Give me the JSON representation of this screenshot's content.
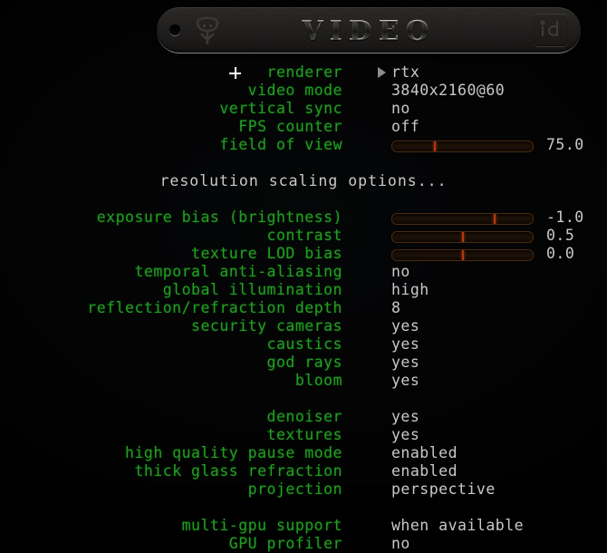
{
  "header": {
    "title": "VIDEO",
    "quake_logo": "quake-logo",
    "id_logo": "id-software-logo"
  },
  "cursor": {
    "icon": "crosshair-cursor"
  },
  "menu": {
    "selection_arrow": "play-arrow-icon",
    "rows": [
      {
        "type": "option",
        "label": "renderer",
        "value": "rtx",
        "selected": true
      },
      {
        "type": "option",
        "label": "video mode",
        "value": "3840x2160@60"
      },
      {
        "type": "option",
        "label": "vertical sync",
        "value": "no"
      },
      {
        "type": "option",
        "label": "FPS counter",
        "value": "off"
      },
      {
        "type": "slider",
        "label": "field of view",
        "value": "75.0",
        "fill": 30
      },
      {
        "type": "spacer"
      },
      {
        "type": "submenu",
        "label": "resolution scaling options..."
      },
      {
        "type": "spacer"
      },
      {
        "type": "slider",
        "label": "exposure bias (brightness)",
        "value": "-1.0",
        "fill": 73
      },
      {
        "type": "slider",
        "label": "contrast",
        "value": "0.5",
        "fill": 50
      },
      {
        "type": "slider",
        "label": "texture LOD bias",
        "value": "0.0",
        "fill": 50
      },
      {
        "type": "option",
        "label": "temporal anti-aliasing",
        "value": "no"
      },
      {
        "type": "option",
        "label": "global illumination",
        "value": "high"
      },
      {
        "type": "option",
        "label": "reflection/refraction depth",
        "value": "8"
      },
      {
        "type": "option",
        "label": "security cameras",
        "value": "yes"
      },
      {
        "type": "option",
        "label": "caustics",
        "value": "yes"
      },
      {
        "type": "option",
        "label": "god rays",
        "value": "yes"
      },
      {
        "type": "option",
        "label": "bloom",
        "value": "yes"
      },
      {
        "type": "spacer"
      },
      {
        "type": "option",
        "label": "denoiser",
        "value": "yes"
      },
      {
        "type": "option",
        "label": "textures",
        "value": "yes"
      },
      {
        "type": "option",
        "label": "high quality pause mode",
        "value": "enabled"
      },
      {
        "type": "option",
        "label": "thick glass refraction",
        "value": "enabled"
      },
      {
        "type": "option",
        "label": "projection",
        "value": "perspective"
      },
      {
        "type": "spacer"
      },
      {
        "type": "option",
        "label": "multi-gpu support",
        "value": "when available"
      },
      {
        "type": "option",
        "label": "GPU profiler",
        "value": "no"
      }
    ]
  },
  "colors": {
    "label_green": "#20a020",
    "value_gray": "#c9c9c9",
    "slider_marker": "#b8370d",
    "background": "#000000"
  }
}
